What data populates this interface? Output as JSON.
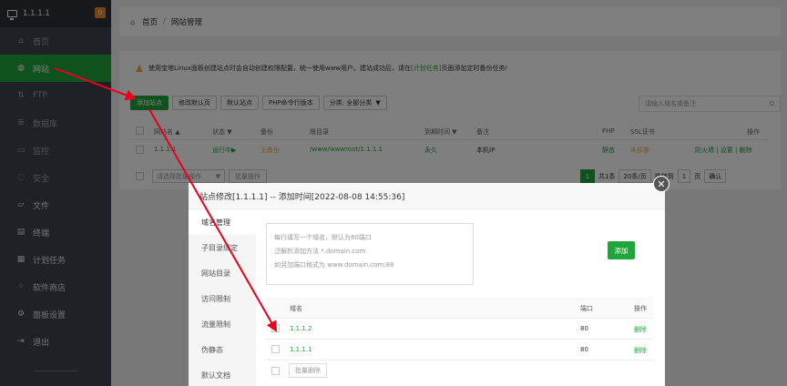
{
  "sidebar": {
    "server": "1.1.1.1",
    "badge": "0",
    "items": [
      {
        "label": "首页",
        "icon": "home-icon",
        "glyph": "⌂"
      },
      {
        "label": "网站",
        "icon": "globe-icon",
        "glyph": "◍"
      },
      {
        "label": "FTP",
        "icon": "ftp-icon",
        "glyph": "⇅"
      },
      {
        "label": "数据库",
        "icon": "database-icon",
        "glyph": "≣"
      },
      {
        "label": "监控",
        "icon": "monitor-icon",
        "glyph": "▭"
      },
      {
        "label": "安全",
        "icon": "shield-icon",
        "glyph": "◌"
      },
      {
        "label": "文件",
        "icon": "folder-icon",
        "glyph": "▱"
      },
      {
        "label": "终端",
        "icon": "terminal-icon",
        "glyph": "▤"
      },
      {
        "label": "计划任务",
        "icon": "calendar-icon",
        "glyph": "▦"
      },
      {
        "label": "软件商店",
        "icon": "apps-icon",
        "glyph": "⁘"
      },
      {
        "label": "面板设置",
        "icon": "gear-icon",
        "glyph": "⚙"
      },
      {
        "label": "退出",
        "icon": "logout-icon",
        "glyph": "⇥"
      }
    ]
  },
  "breadcrumb": {
    "home": "首页",
    "sep": "/",
    "current": "网站管理"
  },
  "notice": {
    "before": "使用宝塔Linux面板创建站点时会自动创建权限配置，统一使用www用户。建站成功后，请在",
    "link": "[计划任务]",
    "after": "页面添加定时备份任务!"
  },
  "toolbar": {
    "add_site": "添加站点",
    "edit_default_page": "修改默认页",
    "default_site": "默认站点",
    "php_cli": "PHP命令行版本",
    "category": "分类: 全部分类",
    "search_placeholder": "请输入域名或备注"
  },
  "table": {
    "headers": {
      "name": "网站名 ▲",
      "status": "状态 ▼",
      "backup": "备份",
      "root": "根目录",
      "expire": "到期时间 ▼",
      "note": "备注",
      "php": "PHP",
      "ssl": "SSL证书",
      "ops": "操作"
    },
    "row": {
      "name": "1.1.1.1",
      "status": "运行中▶",
      "backup": "无备份",
      "root": "/www/wwwroot/1.1.1.1",
      "expire": "永久",
      "note": "本机IP",
      "php": "静态",
      "ssl": "未部署",
      "ops": "防火墙 | 设置 | 删除"
    }
  },
  "footer": {
    "select_placeholder": "请选择批量操作",
    "bulk": "批量操作",
    "page": "1",
    "total": "共1条",
    "per_page": "20条/页",
    "goto": "跳转到",
    "goto_page": "1",
    "page_unit": "页",
    "confirm": "确认"
  },
  "dialog": {
    "title": "站点修改[1.1.1.1] -- 添加时间[2022-08-08 14:55:36]",
    "nav": [
      "域名管理",
      "子目录绑定",
      "网站目录",
      "访问限制",
      "流量限制",
      "伪静态",
      "默认文档"
    ],
    "textarea_lines": [
      "每行填写一个域名，默认为80端口",
      "泛解析添加方法 *.domain.com",
      "如另加端口格式为 www.domain.com:88"
    ],
    "add": "添加",
    "headers": {
      "domain": "域名",
      "port": "端口",
      "ops": "操作"
    },
    "rows": [
      {
        "domain": "1.1.1.2",
        "port": "80",
        "op": "删除"
      },
      {
        "domain": "1.1.1.1",
        "port": "80",
        "op": "删除"
      }
    ],
    "bulk_delete": "批量删除"
  },
  "colors": {
    "accent": "#20a53a",
    "warn": "#f0ad4e",
    "arrow": "#e8001c",
    "sidebar": "#3c444d"
  }
}
